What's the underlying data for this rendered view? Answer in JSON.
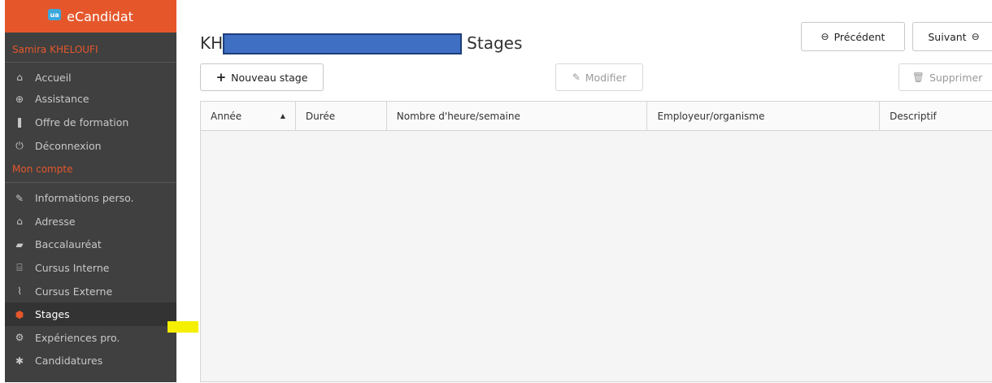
{
  "brand": {
    "name": "eCandidat",
    "logo_text": "ua"
  },
  "user": {
    "name": "Samira KHELOUFI"
  },
  "menu_main": [
    {
      "label": "Accueil",
      "icon": "home-icon",
      "glyph": "⌂"
    },
    {
      "label": "Assistance",
      "icon": "lifebuoy-icon",
      "glyph": "⊕"
    },
    {
      "label": "Offre de formation",
      "icon": "bookmark-icon",
      "glyph": "❚"
    },
    {
      "label": "Déconnexion",
      "icon": "power-icon",
      "glyph": "⏻"
    }
  ],
  "account_section": {
    "label": "Mon compte"
  },
  "menu_account": [
    {
      "label": "Informations perso.",
      "icon": "pencil-icon",
      "glyph": "✎",
      "active": false
    },
    {
      "label": "Adresse",
      "icon": "home-icon",
      "glyph": "⌂",
      "active": false
    },
    {
      "label": "Baccalauréat",
      "icon": "book-icon",
      "glyph": "▰",
      "active": false
    },
    {
      "label": "Cursus Interne",
      "icon": "institution-icon",
      "glyph": "⌸",
      "active": false
    },
    {
      "label": "Cursus Externe",
      "icon": "graduation-cap-icon",
      "glyph": "⌇",
      "active": false
    },
    {
      "label": "Stages",
      "icon": "cube-icon",
      "glyph": "⬢",
      "active": true
    },
    {
      "label": "Expériences pro.",
      "icon": "cogs-icon",
      "glyph": "⚙",
      "active": false
    },
    {
      "label": "Candidatures",
      "icon": "asterisk-icon",
      "glyph": "✱",
      "active": false
    }
  ],
  "page": {
    "title_prefix": "KH",
    "title_suffix": "Stages"
  },
  "nav": {
    "previous_label": "Précédent",
    "next_label": "Suivant"
  },
  "toolbar": {
    "new_label": "Nouveau stage",
    "edit_label": "Modifier",
    "delete_label": "Supprimer"
  },
  "table": {
    "columns": [
      "Année",
      "Durée",
      "Nombre d'heure/semaine",
      "Employeur/organisme",
      "Descriptif"
    ],
    "rows": []
  },
  "colors": {
    "brand": "#e5572b",
    "sidebar_bg": "#404040",
    "redaction": "#3f6fc3",
    "highlight": "#f5ef00"
  }
}
